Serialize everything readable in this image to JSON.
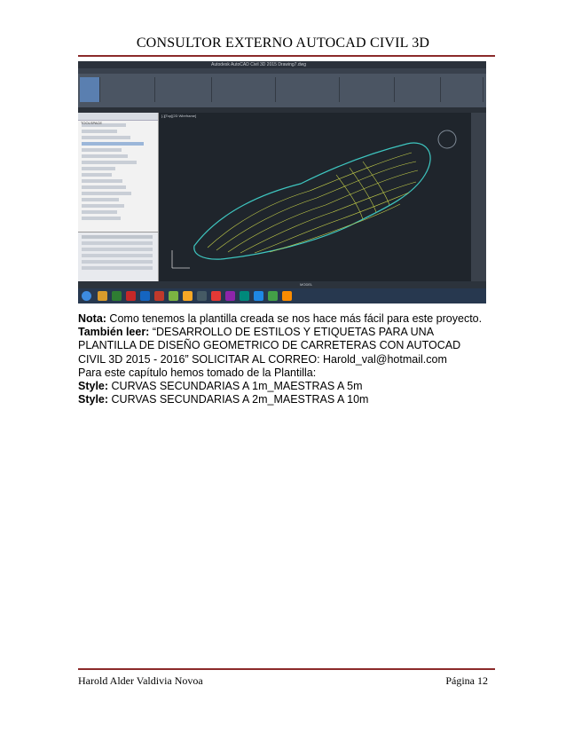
{
  "header": {
    "title": "CONSULTOR EXTERNO AUTOCAD CIVIL 3D"
  },
  "body": {
    "line1": {
      "label": "Nota:",
      "text": " Como tenemos la plantilla creada se nos hace más fácil para este proyecto."
    },
    "line2": {
      "label": "También leer:",
      "text": " “DESARROLLO DE ESTILOS Y ETIQUETAS PARA UNA"
    },
    "line3": "PLANTILLA DE DISEÑO GEOMETRICO DE CARRETERAS CON AUTOCAD",
    "line4": "CIVIL 3D 2015 - 2016” SOLICITAR AL CORREO: Harold_val@hotmail.com",
    "line5": "Para este capítulo hemos tomado de la Plantilla:",
    "line6": {
      "label": "Style:",
      "text": " CURVAS SECUNDARIAS A 1m_MAESTRAS A 5m"
    },
    "line7": {
      "label": "Style:",
      "text": " CURVAS SECUNDARIAS A 2m_MAESTRAS A 10m"
    }
  },
  "screenshot": {
    "window_title": "Autodesk AutoCAD Civil 3D 2015  Drawing7.dwg",
    "toolspace_label": "TOOLSPACE",
    "drawing_label": "Drawing7",
    "viewport_label": "[-][Top][2D Wireframe]",
    "selected_item": "Puntos Topograficos",
    "status_label": "MODEL",
    "colors": {
      "contour": "#c7d24a",
      "boundary": "#3ec6c0",
      "background": "#1f252c"
    }
  },
  "footer": {
    "author": "Harold Alder Valdivia Novoa",
    "page": "Página 12"
  }
}
